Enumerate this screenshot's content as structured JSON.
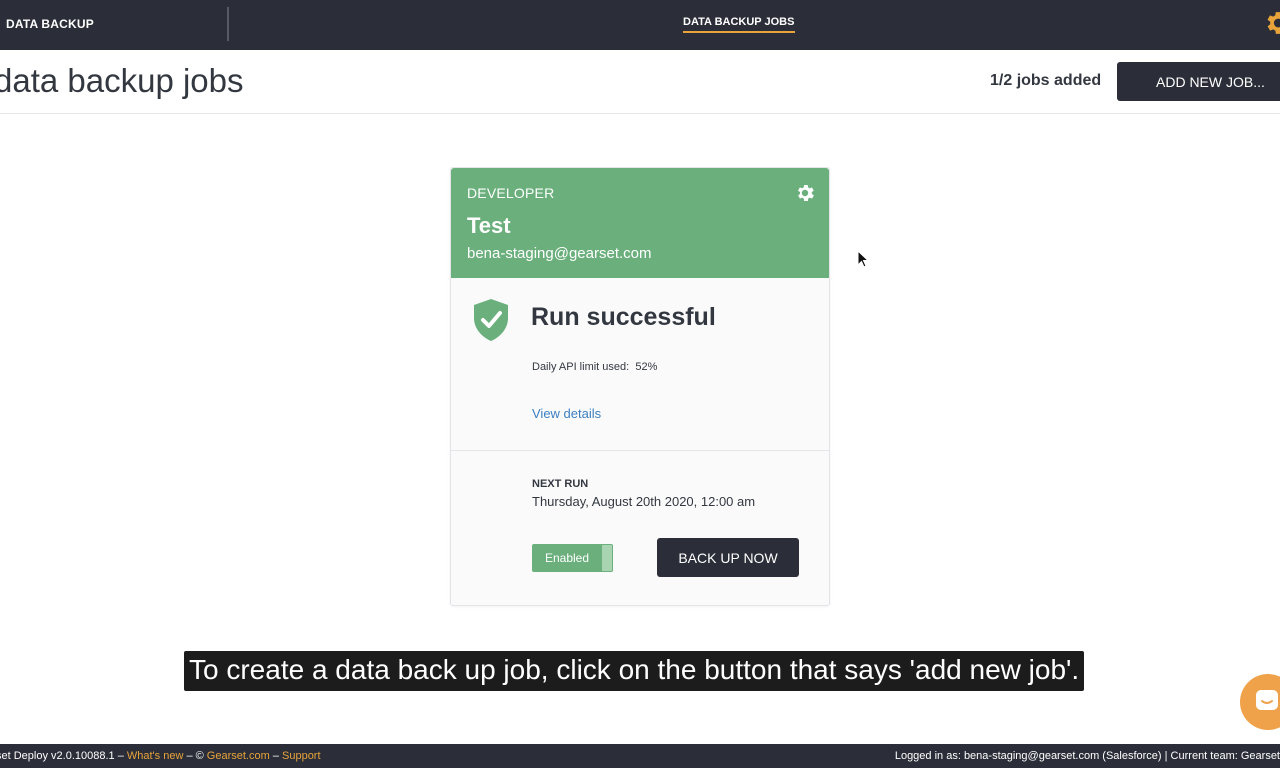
{
  "topbar": {
    "app_name": "DATA BACKUP",
    "nav_tab": "DATA BACKUP JOBS"
  },
  "page": {
    "title": "data backup jobs",
    "jobs_count": "1/2 jobs added",
    "add_button": "ADD NEW JOB..."
  },
  "card": {
    "org_type": "DEVELOPER",
    "org_name": "Test",
    "org_user": "bena-staging@gearset.com",
    "status": "Run successful",
    "api_label": "Daily API limit used:",
    "api_value": "52%",
    "view_details": "View details",
    "next_run_label": "NEXT RUN",
    "next_run_date": "Thursday, August 20th 2020, 12:00 am",
    "toggle_label": "Enabled",
    "backup_button": "BACK UP NOW"
  },
  "caption": "To create a data back up job, click on the button that says 'add new job'.",
  "footer": {
    "version": "set Deploy v2.0.10088.1 – ",
    "whats_new": "What's new",
    "sep1": " – © ",
    "gearset_link": "Gearset.com",
    "sep2": " – ",
    "support": "Support",
    "logged_in": "Logged in as: bena-staging@gearset.com (Salesforce) | Current team: Gearset"
  },
  "icons": {
    "top_gear": "gear-icon",
    "card_gear": "gear-icon",
    "status": "shield-check-icon",
    "chat": "chat-icon"
  },
  "colors": {
    "topbar": "#2b2e38",
    "accent": "#e8a33a",
    "success": "#6aaf7c",
    "link": "#3b7fc0"
  }
}
